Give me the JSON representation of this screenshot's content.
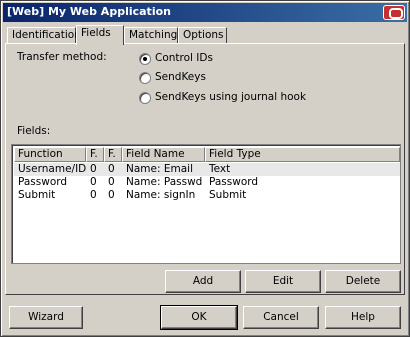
{
  "window": {
    "title": "[Web] My Web Application"
  },
  "tabs": [
    {
      "label": "Identification"
    },
    {
      "label": "Fields"
    },
    {
      "label": "Matching"
    },
    {
      "label": "Options"
    }
  ],
  "transfer": {
    "label": "Transfer method:",
    "options": [
      {
        "label": "Control IDs",
        "checked": true
      },
      {
        "label": "SendKeys",
        "checked": false
      },
      {
        "label": "SendKeys using journal hook",
        "checked": false
      }
    ]
  },
  "fields": {
    "label": "Fields:",
    "columns": [
      "Function",
      "F.",
      "F.",
      "Field Name",
      "Field Type"
    ],
    "rows": [
      [
        "Username/ID",
        "0",
        "0",
        "Name: Email",
        "Text"
      ],
      [
        "Password",
        "0",
        "0",
        "Name: Passwd",
        "Password"
      ],
      [
        "Submit",
        "0",
        "0",
        "Name: signIn",
        "Submit"
      ]
    ]
  },
  "list_buttons": {
    "add": "Add",
    "edit": "Edit",
    "delete": "Delete"
  },
  "dialog_buttons": {
    "wizard": "Wizard",
    "ok": "OK",
    "cancel": "Cancel",
    "help": "Help"
  },
  "colors": {
    "title_start": "#0a246a",
    "title_end": "#3a6ea5",
    "close": "#c53030",
    "face": "#d4d0c8"
  }
}
